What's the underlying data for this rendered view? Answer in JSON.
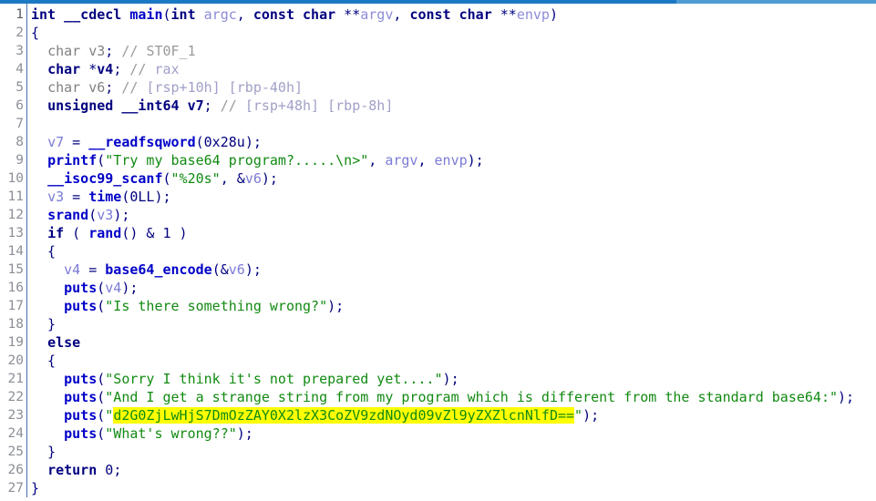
{
  "window": {
    "title": "IDA Pseudocode View",
    "accent_color": "#1b79c4",
    "accent_color_light": "#4e9bd4",
    "background": "#ffffff",
    "gutter_divider_color": "#4a6fae"
  },
  "colors": {
    "keyword": "#00007f",
    "function": "#0000c8",
    "variable": "#7b7bd6",
    "argument": "#8c8cd9",
    "string": "#128a12",
    "comment": "#9a9a9a",
    "comment_ref": "#a0a0c8",
    "dimmed_type": "#808080",
    "highlight_background": "#ffff00",
    "line_number": "#8b8f96"
  },
  "highlight": {
    "text": "d2G0ZjLwHjS7DmOzZAY0X2lzX3CoZV9zdNOyd09vZl9yZXZlcnNlfD==",
    "background": "#ffff00",
    "line": 23
  },
  "editor": {
    "first_line_number": 1,
    "last_line_number": 27,
    "total_lines": 27,
    "line_numbers": [
      1,
      2,
      3,
      4,
      5,
      6,
      7,
      8,
      9,
      10,
      11,
      12,
      13,
      14,
      15,
      16,
      17,
      18,
      19,
      20,
      21,
      22,
      23,
      24,
      25,
      26,
      27
    ]
  },
  "code_lines": [
    {
      "number": 1,
      "text": "int __cdecl main(int argc, const char **argv, const char **envp)",
      "tokens": [
        {
          "t": "int",
          "c": "kw"
        },
        {
          "t": " ",
          "c": "plain"
        },
        {
          "t": "__cdecl",
          "c": "kw"
        },
        {
          "t": " ",
          "c": "plain"
        },
        {
          "t": "main",
          "c": "func"
        },
        {
          "t": "(",
          "c": "plain"
        },
        {
          "t": "int",
          "c": "kw"
        },
        {
          "t": " ",
          "c": "plain"
        },
        {
          "t": "argc",
          "c": "arg"
        },
        {
          "t": ", ",
          "c": "plain"
        },
        {
          "t": "const",
          "c": "kw"
        },
        {
          "t": " ",
          "c": "plain"
        },
        {
          "t": "char",
          "c": "kw"
        },
        {
          "t": " **",
          "c": "plain"
        },
        {
          "t": "argv",
          "c": "arg"
        },
        {
          "t": ", ",
          "c": "plain"
        },
        {
          "t": "const",
          "c": "kw"
        },
        {
          "t": " ",
          "c": "plain"
        },
        {
          "t": "char",
          "c": "kw"
        },
        {
          "t": " **",
          "c": "plain"
        },
        {
          "t": "envp",
          "c": "arg"
        },
        {
          "t": ")",
          "c": "plain"
        }
      ]
    },
    {
      "number": 2,
      "text": "{",
      "tokens": [
        {
          "t": "{",
          "c": "plain"
        }
      ]
    },
    {
      "number": 3,
      "text": "  char v3; // ST0F_1",
      "tokens": [
        {
          "t": "  ",
          "c": "plain"
        },
        {
          "t": "char",
          "c": "type"
        },
        {
          "t": " ",
          "c": "plain"
        },
        {
          "t": "v3",
          "c": "type"
        },
        {
          "t": ";",
          "c": "plain"
        },
        {
          "t": " ",
          "c": "plain"
        },
        {
          "t": "//",
          "c": "cmt"
        },
        {
          "t": " ",
          "c": "plain"
        },
        {
          "t": "ST0F_1",
          "c": "cmt"
        }
      ]
    },
    {
      "number": 4,
      "text": "  char *v4; // rax",
      "tokens": [
        {
          "t": "  ",
          "c": "plain"
        },
        {
          "t": "char",
          "c": "kw"
        },
        {
          "t": " *",
          "c": "plain"
        },
        {
          "t": "v4",
          "c": "kw"
        },
        {
          "t": ";",
          "c": "plain"
        },
        {
          "t": " ",
          "c": "plain"
        },
        {
          "t": "//",
          "c": "cmt"
        },
        {
          "t": " ",
          "c": "plain"
        },
        {
          "t": "rax",
          "c": "cmtref"
        }
      ]
    },
    {
      "number": 5,
      "text": "  char v6; // [rsp+10h] [rbp-40h]",
      "tokens": [
        {
          "t": "  ",
          "c": "plain"
        },
        {
          "t": "char",
          "c": "type"
        },
        {
          "t": " ",
          "c": "plain"
        },
        {
          "t": "v6",
          "c": "type"
        },
        {
          "t": ";",
          "c": "plain"
        },
        {
          "t": " ",
          "c": "plain"
        },
        {
          "t": "//",
          "c": "cmt"
        },
        {
          "t": " ",
          "c": "plain"
        },
        {
          "t": "[rsp+10h] [rbp-40h]",
          "c": "cmtref"
        }
      ]
    },
    {
      "number": 6,
      "text": "  unsigned __int64 v7; // [rsp+48h] [rbp-8h]",
      "tokens": [
        {
          "t": "  ",
          "c": "plain"
        },
        {
          "t": "unsigned",
          "c": "kw"
        },
        {
          "t": " ",
          "c": "plain"
        },
        {
          "t": "__int64",
          "c": "kw"
        },
        {
          "t": " ",
          "c": "plain"
        },
        {
          "t": "v7",
          "c": "kw"
        },
        {
          "t": ";",
          "c": "plain"
        },
        {
          "t": " ",
          "c": "plain"
        },
        {
          "t": "//",
          "c": "cmt"
        },
        {
          "t": " ",
          "c": "plain"
        },
        {
          "t": "[rsp+48h] [rbp-8h]",
          "c": "cmtref"
        }
      ]
    },
    {
      "number": 7,
      "text": "",
      "tokens": []
    },
    {
      "number": 8,
      "text": "  v7 = __readfsqword(0x28u);",
      "tokens": [
        {
          "t": "  ",
          "c": "plain"
        },
        {
          "t": "v7",
          "c": "var"
        },
        {
          "t": " = ",
          "c": "plain"
        },
        {
          "t": "__readfsqword",
          "c": "func"
        },
        {
          "t": "(",
          "c": "plain"
        },
        {
          "t": "0x28u",
          "c": "num"
        },
        {
          "t": ");",
          "c": "plain"
        }
      ]
    },
    {
      "number": 9,
      "text": "  printf(\"Try my base64 program?.....\\n>\", argv, envp);",
      "tokens": [
        {
          "t": "  ",
          "c": "plain"
        },
        {
          "t": "printf",
          "c": "func"
        },
        {
          "t": "(",
          "c": "plain"
        },
        {
          "t": "\"Try my base64 program?.....\\n>\"",
          "c": "str"
        },
        {
          "t": ", ",
          "c": "plain"
        },
        {
          "t": "argv",
          "c": "var"
        },
        {
          "t": ", ",
          "c": "plain"
        },
        {
          "t": "envp",
          "c": "var"
        },
        {
          "t": ");",
          "c": "plain"
        }
      ]
    },
    {
      "number": 10,
      "text": "  __isoc99_scanf(\"%20s\", &v6);",
      "tokens": [
        {
          "t": "  ",
          "c": "plain"
        },
        {
          "t": "__isoc99_scanf",
          "c": "func"
        },
        {
          "t": "(",
          "c": "plain"
        },
        {
          "t": "\"%20s\"",
          "c": "str"
        },
        {
          "t": ", &",
          "c": "plain"
        },
        {
          "t": "v6",
          "c": "var"
        },
        {
          "t": ");",
          "c": "plain"
        }
      ]
    },
    {
      "number": 11,
      "text": "  v3 = time(0LL);",
      "tokens": [
        {
          "t": "  ",
          "c": "plain"
        },
        {
          "t": "v3",
          "c": "var"
        },
        {
          "t": " = ",
          "c": "plain"
        },
        {
          "t": "time",
          "c": "func"
        },
        {
          "t": "(",
          "c": "plain"
        },
        {
          "t": "0LL",
          "c": "num"
        },
        {
          "t": ");",
          "c": "plain"
        }
      ]
    },
    {
      "number": 12,
      "text": "  srand(v3);",
      "tokens": [
        {
          "t": "  ",
          "c": "plain"
        },
        {
          "t": "srand",
          "c": "func"
        },
        {
          "t": "(",
          "c": "plain"
        },
        {
          "t": "v3",
          "c": "var"
        },
        {
          "t": ");",
          "c": "plain"
        }
      ]
    },
    {
      "number": 13,
      "text": "  if ( rand() & 1 )",
      "tokens": [
        {
          "t": "  ",
          "c": "plain"
        },
        {
          "t": "if",
          "c": "kw"
        },
        {
          "t": " ( ",
          "c": "plain"
        },
        {
          "t": "rand",
          "c": "func"
        },
        {
          "t": "() & ",
          "c": "plain"
        },
        {
          "t": "1",
          "c": "num"
        },
        {
          "t": " )",
          "c": "plain"
        }
      ]
    },
    {
      "number": 14,
      "text": "  {",
      "tokens": [
        {
          "t": "  {",
          "c": "plain"
        }
      ]
    },
    {
      "number": 15,
      "text": "    v4 = base64_encode(&v6);",
      "tokens": [
        {
          "t": "    ",
          "c": "plain"
        },
        {
          "t": "v4",
          "c": "var"
        },
        {
          "t": " = ",
          "c": "plain"
        },
        {
          "t": "base64_encode",
          "c": "func"
        },
        {
          "t": "(&",
          "c": "plain"
        },
        {
          "t": "v6",
          "c": "var"
        },
        {
          "t": ");",
          "c": "plain"
        }
      ]
    },
    {
      "number": 16,
      "text": "    puts(v4);",
      "tokens": [
        {
          "t": "    ",
          "c": "plain"
        },
        {
          "t": "puts",
          "c": "func"
        },
        {
          "t": "(",
          "c": "plain"
        },
        {
          "t": "v4",
          "c": "var"
        },
        {
          "t": ");",
          "c": "plain"
        }
      ]
    },
    {
      "number": 17,
      "text": "    puts(\"Is there something wrong?\");",
      "tokens": [
        {
          "t": "    ",
          "c": "plain"
        },
        {
          "t": "puts",
          "c": "func"
        },
        {
          "t": "(",
          "c": "plain"
        },
        {
          "t": "\"Is there something wrong?\"",
          "c": "str"
        },
        {
          "t": ");",
          "c": "plain"
        }
      ]
    },
    {
      "number": 18,
      "text": "  }",
      "tokens": [
        {
          "t": "  }",
          "c": "plain"
        }
      ]
    },
    {
      "number": 19,
      "text": "  else",
      "tokens": [
        {
          "t": "  ",
          "c": "plain"
        },
        {
          "t": "else",
          "c": "kw"
        }
      ]
    },
    {
      "number": 20,
      "text": "  {",
      "tokens": [
        {
          "t": "  {",
          "c": "plain"
        }
      ]
    },
    {
      "number": 21,
      "text": "    puts(\"Sorry I think it's not prepared yet....\");",
      "tokens": [
        {
          "t": "    ",
          "c": "plain"
        },
        {
          "t": "puts",
          "c": "func"
        },
        {
          "t": "(",
          "c": "plain"
        },
        {
          "t": "\"Sorry I think it's not prepared yet....\"",
          "c": "str"
        },
        {
          "t": ");",
          "c": "plain"
        }
      ]
    },
    {
      "number": 22,
      "text": "    puts(\"And I get a strange string from my program which is different from the standard base64:\");",
      "tokens": [
        {
          "t": "    ",
          "c": "plain"
        },
        {
          "t": "puts",
          "c": "func"
        },
        {
          "t": "(",
          "c": "plain"
        },
        {
          "t": "\"And I get a strange string from my program which is different from the standard base64:\"",
          "c": "str"
        },
        {
          "t": ");",
          "c": "plain"
        }
      ]
    },
    {
      "number": 23,
      "text": "    puts(\"d2G0ZjLwHjS7DmOzZAY0X2lzX3CoZV9zdNOyd09vZl9yZXZlcnNlfD==\");",
      "tokens": [
        {
          "t": "    ",
          "c": "plain"
        },
        {
          "t": "puts",
          "c": "func"
        },
        {
          "t": "(",
          "c": "plain"
        },
        {
          "t": "\"",
          "c": "str"
        },
        {
          "t": "d2G0ZjLwHjS7DmOzZAY0X2lzX3CoZV9zdNOyd09vZl9yZXZlcnNlfD==",
          "c": "hl"
        },
        {
          "t": "\"",
          "c": "str"
        },
        {
          "t": ");",
          "c": "plain"
        }
      ]
    },
    {
      "number": 24,
      "text": "    puts(\"What's wrong??\");",
      "tokens": [
        {
          "t": "    ",
          "c": "plain"
        },
        {
          "t": "puts",
          "c": "func"
        },
        {
          "t": "(",
          "c": "plain"
        },
        {
          "t": "\"What's wrong??\"",
          "c": "str"
        },
        {
          "t": ");",
          "c": "plain"
        }
      ]
    },
    {
      "number": 25,
      "text": "  }",
      "tokens": [
        {
          "t": "  }",
          "c": "plain"
        }
      ]
    },
    {
      "number": 26,
      "text": "  return 0;",
      "tokens": [
        {
          "t": "  ",
          "c": "plain"
        },
        {
          "t": "return",
          "c": "kw"
        },
        {
          "t": " ",
          "c": "plain"
        },
        {
          "t": "0",
          "c": "num"
        },
        {
          "t": ";",
          "c": "plain"
        }
      ]
    },
    {
      "number": 27,
      "text": "}",
      "tokens": [
        {
          "t": "}",
          "c": "plain"
        }
      ]
    }
  ]
}
